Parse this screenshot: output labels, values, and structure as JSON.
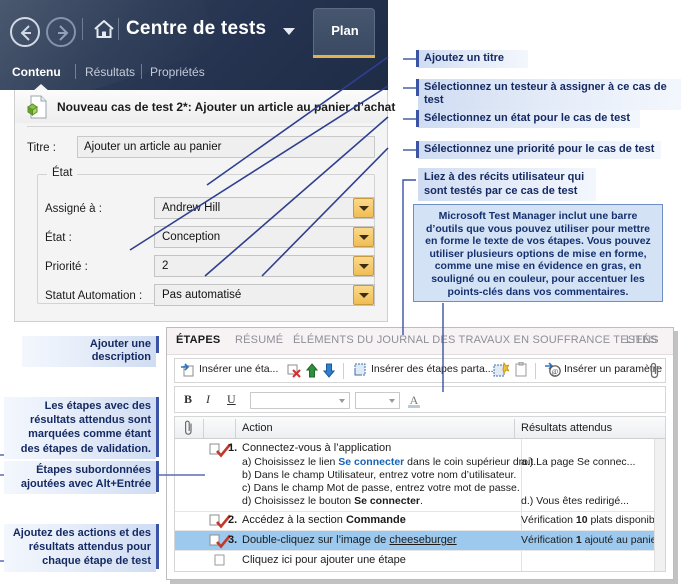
{
  "chrome": {
    "title": "Centre de tests",
    "back_icon": "back-arrow-icon",
    "forward_icon": "forward-arrow-icon",
    "home_icon": "home-icon",
    "dropdown_icon": "chevron-down-icon",
    "plan_tab": "Plan",
    "subtabs": [
      {
        "label": "Contenu",
        "active": true
      },
      {
        "label": "Résultats",
        "active": false
      },
      {
        "label": "Propriétés",
        "active": false
      }
    ]
  },
  "form": {
    "doc_icon": "test-case-document-icon",
    "header_title": "Nouveau cas de test 2*: Ajouter un article au panier d’achat",
    "title_label": "Titre :",
    "title_value": "Ajouter un article au panier",
    "group_legend": "État",
    "fields": [
      {
        "label": "Assigné à :",
        "value": "Andrew Hill"
      },
      {
        "label": "État :",
        "value": "Conception"
      },
      {
        "label": "Priorité :",
        "value": "2"
      },
      {
        "label": "Statut Automation :",
        "value": "Pas automatisé"
      }
    ]
  },
  "steps": {
    "tabs": [
      {
        "label": "ÉTAPES",
        "active": true
      },
      {
        "label": "RÉSUMÉ",
        "active": false
      },
      {
        "label": "ÉLÉMENTS DU JOURNAL DES TRAVAUX EN SOUFFRANCE TESTÉS",
        "active": false
      },
      {
        "label": "LIENS",
        "active": false
      }
    ],
    "toolbar": {
      "insert_step": "Insérer une éta...",
      "insert_step_icon": "insert-step-icon",
      "delete_step_icon": "delete-step-icon",
      "move_up_icon": "arrow-up-icon",
      "move_down_icon": "arrow-down-icon",
      "insert_shared": "Insérer des étapes parta...",
      "insert_shared_icon": "insert-shared-steps-icon",
      "create_shared_icon": "create-shared-steps-icon",
      "paste_icon": "paste-icon",
      "insert_param": "Insérer un paramètre",
      "insert_param_icon": "insert-parameter-icon",
      "attachment_icon": "paperclip-icon"
    },
    "format_toolbar": {
      "bold": "B",
      "italic": "I",
      "underline": "U",
      "font_family": "",
      "font_size": "",
      "font_color_icon": "font-color-icon"
    },
    "grid_headers": {
      "attachment_icon": "paperclip-icon",
      "action": "Action",
      "expected": "Résultats attendus"
    },
    "rows": [
      {
        "num": "1.",
        "icon": "validation-step-icon",
        "action": "Connectez-vous à l’application",
        "substeps": [
          {
            "prefix": "a) Choisissez le lien ",
            "link": "Se connecter",
            "suffix": " dans le coin supérieur droit."
          },
          {
            "prefix": "b) Dans le champ Utilisateur, entrez votre nom d’utilisateur.",
            "link": "",
            "suffix": ""
          },
          {
            "prefix": "c) Dans le champ Mot de passe, entrez votre mot de passe.",
            "link": "",
            "suffix": ""
          },
          {
            "prefix": "d) Choisissez le bouton ",
            "bold": "Se connecter",
            "suffix": "."
          }
        ],
        "expected_a": "a.) La page Se connec...",
        "expected_d": "d.) Vous êtes redirigé...",
        "selected": false
      },
      {
        "num": "2.",
        "icon": "validation-step-icon",
        "action_prefix": "Accédez à la section ",
        "action_bold": "Commande",
        "expected_prefix": "Vérification ",
        "expected_bold": "10",
        "expected_suffix": " plats disponibles",
        "selected": false
      },
      {
        "num": "3.",
        "icon": "validation-step-icon",
        "action_prefix": "Double-cliquez sur l’image de ",
        "action_link": "cheeseburger",
        "expected_prefix": "Vérification ",
        "expected_bold": "1",
        "expected_suffix": " ajouté au panier",
        "selected": true
      }
    ],
    "add_row": {
      "icon": "new-step-icon",
      "text": "Cliquez ici pour ajouter une étape"
    }
  },
  "callouts": {
    "right": [
      {
        "text": "Ajoutez un titre"
      },
      {
        "text": "Sélectionnez un testeur à assigner à ce cas de test"
      },
      {
        "text": "Sélectionnez un état pour le cas de test"
      },
      {
        "text": "Sélectionnez une priorité pour le cas de test"
      },
      {
        "line1": "Liez à des récits utilisateur qui",
        "line2": "sont testés par ce cas de test"
      }
    ],
    "tip": "Microsoft Test Manager inclut une barre d’outils que vous pouvez utiliser pour mettre en forme le texte de vos étapes. Vous pouvez utiliser plusieurs options de mise en forme, comme une mise en évidence en gras, en souligné ou en couleur, pour accentuer les points-clés dans vos commentaires.",
    "left": [
      {
        "text": "Ajouter une description"
      },
      {
        "line1": "Les étapes avec des",
        "line2": "résultats attendus sont",
        "line3": "marquées comme étant",
        "line4": "des étapes de validation."
      },
      {
        "line1": "Étapes subordonnées",
        "line2": "ajoutées avec Alt+Entrée"
      },
      {
        "line1": "Ajoutez des actions et des",
        "line2": "résultats attendus pour",
        "line3": "chaque étape de test"
      }
    ]
  },
  "colors": {
    "chrome_dark": "#253350",
    "accent_gold": "#e0b44c",
    "callout_text": "#152a63",
    "callout_bar": "#3a53a4",
    "selection": "#9dc9ee",
    "link": "#1663b5"
  }
}
